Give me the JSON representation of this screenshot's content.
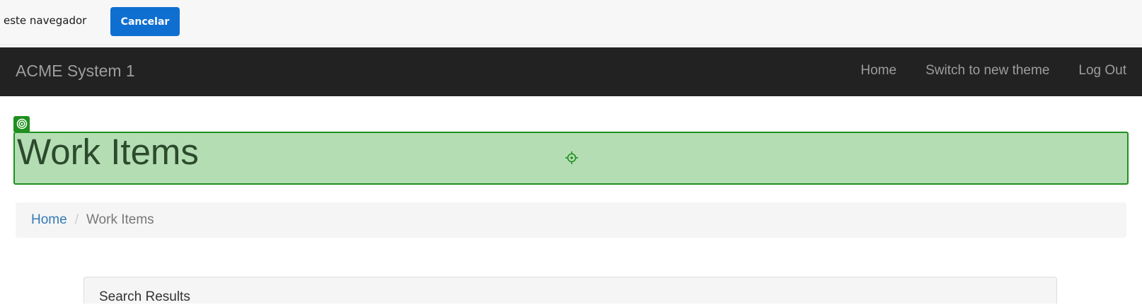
{
  "notification": {
    "text": "este navegador",
    "cancel_label": "Cancelar"
  },
  "navbar": {
    "brand": "ACME System 1",
    "links": [
      {
        "label": "Home"
      },
      {
        "label": "Switch to new theme"
      },
      {
        "label": "Log Out"
      }
    ]
  },
  "page": {
    "title": "Work Items"
  },
  "breadcrumb": {
    "home": "Home",
    "separator": "/",
    "current": "Work Items"
  },
  "panel": {
    "title": "Search Results"
  },
  "colors": {
    "navbar_bg": "#222222",
    "cancel_button": "#0f6fd1",
    "highlight_fill": "#b4ddb4",
    "highlight_border": "#1f8f1f",
    "link": "#337ab7"
  },
  "icons": {
    "heading_badge": "target-rings-icon",
    "center_marker": "crosshair-icon"
  }
}
